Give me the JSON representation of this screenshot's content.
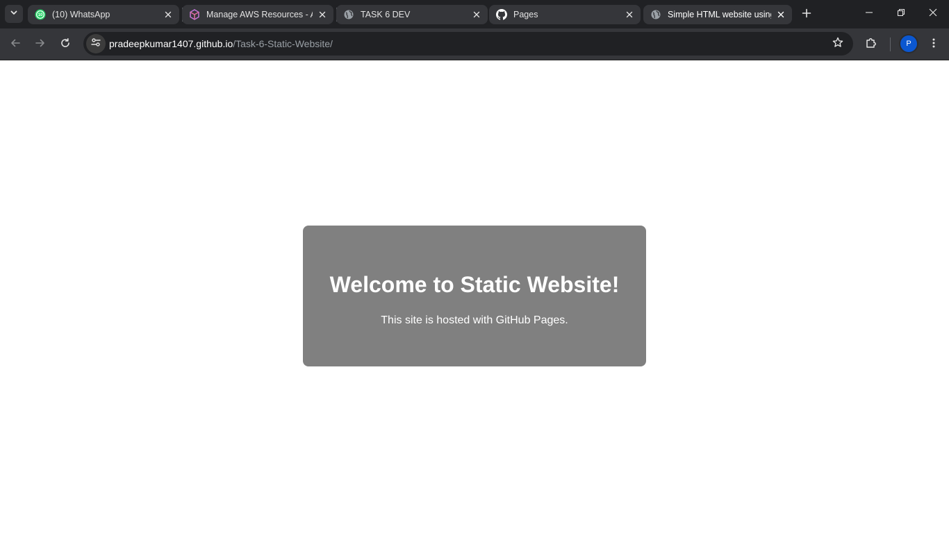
{
  "browser": {
    "tabs": [
      {
        "title": "(10) WhatsApp",
        "favicon": "whatsapp-icon",
        "badge": "10",
        "active": false
      },
      {
        "title": "Manage AWS Resources - AW",
        "favicon": "aws-cube-icon",
        "active": false
      },
      {
        "title": "TASK 6 DEV",
        "favicon": "globe-icon",
        "active": false
      },
      {
        "title": "Pages",
        "favicon": "github-icon",
        "active": false
      },
      {
        "title": "Simple HTML website using",
        "favicon": "globe-icon",
        "active": true
      }
    ],
    "address": {
      "host": "pradeepkumar1407.github.io",
      "path": "/Task-6-Static-Website/"
    },
    "profile_initial": "P",
    "colors": {
      "tab_strip": "#202124",
      "toolbar": "#35363a",
      "omnibox": "#202124",
      "avatar": "#0b57d0"
    }
  },
  "page": {
    "heading": "Welcome to Static Website!",
    "subtext": "This site is hosted with GitHub Pages.",
    "colors": {
      "background": "#ffffff",
      "card": "#808080",
      "card_text": "#ffffff"
    }
  }
}
